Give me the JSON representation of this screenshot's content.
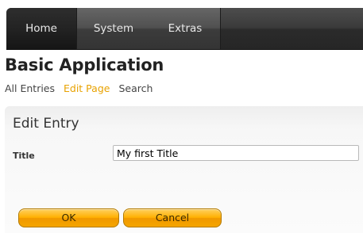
{
  "nav": {
    "tabs": [
      {
        "label": "Home"
      },
      {
        "label": "System"
      },
      {
        "label": "Extras"
      }
    ]
  },
  "app": {
    "title": "Basic Application"
  },
  "subnav": {
    "items": [
      {
        "label": "All Entries"
      },
      {
        "label": "Edit Page",
        "active": true
      },
      {
        "label": "Search"
      }
    ]
  },
  "form": {
    "heading": "Edit Entry",
    "fields": [
      {
        "label": "Title",
        "value": "My first Title"
      }
    ],
    "buttons": {
      "ok_label": "OK",
      "cancel_label": "Cancel"
    }
  },
  "colors": {
    "nav_dark": "#2b2b2b",
    "accent": "#e8a200",
    "button_orange": "#ffb000"
  }
}
